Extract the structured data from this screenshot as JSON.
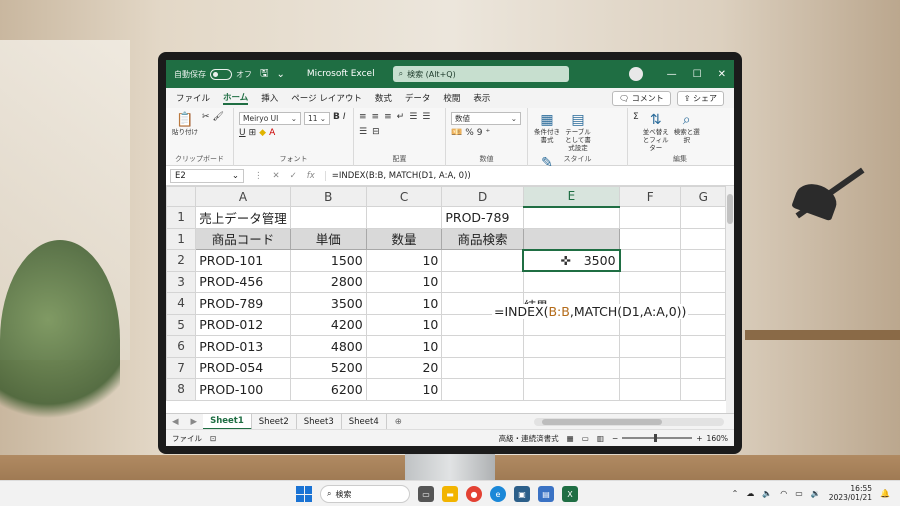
{
  "titlebar": {
    "autosave": "自動保存",
    "autosave_state": "オフ",
    "app": "Microsoft Excel",
    "search": "検索 (Alt+Q)"
  },
  "menu": [
    "ファイル",
    "ホーム",
    "挿入",
    "ページ レイアウト",
    "数式",
    "データ",
    "校閲",
    "表示"
  ],
  "menu_active": "ホーム",
  "menu_right": {
    "comment": "コメント",
    "share": "シェア"
  },
  "ribbon": {
    "paste": "貼り付け",
    "clipboard": "クリップボード",
    "font_name": "Meiryo UI",
    "font_size": "11",
    "font": "フォント",
    "alignment": "配置",
    "number_format": "数値",
    "number": "数値",
    "styles": "スタイル",
    "cond_format": "条件付き書式",
    "table_format": "テーブルとして書式設定",
    "cell_style": "セルのスタイル",
    "editing": "編集",
    "sort": "並べ替えとフィルター",
    "find": "検索と選択"
  },
  "formula_bar": {
    "namebox": "E2",
    "formula": "=INDEX(B:B, MATCH(D1, A:A, 0))"
  },
  "columns": [
    "A",
    "B",
    "C",
    "D",
    "E",
    "F",
    "G"
  ],
  "selected_column": "E",
  "rows": [
    {
      "n": "1",
      "a": "売上データ管理",
      "b": "",
      "c": "",
      "d": "PROD-789",
      "e": ""
    },
    {
      "n": "1",
      "a": "商品コード",
      "b": "単価",
      "c": "数量",
      "d": "商品検索",
      "e": "結果"
    },
    {
      "n": "2",
      "a": "PROD-101",
      "b": "1500",
      "c": "10",
      "d": "",
      "e": "3500"
    },
    {
      "n": "3",
      "a": "PROD-456",
      "b": "2800",
      "c": "10",
      "d": "",
      "e": ""
    },
    {
      "n": "4",
      "a": "PROD-789",
      "b": "3500",
      "c": "10",
      "d": "",
      "e": ""
    },
    {
      "n": "5",
      "a": "PROD-012",
      "b": "4200",
      "c": "10",
      "d": "",
      "e": ""
    },
    {
      "n": "6",
      "a": "PROD-013",
      "b": "4800",
      "c": "10",
      "d": "",
      "e": ""
    },
    {
      "n": "7",
      "a": "PROD-054",
      "b": "5200",
      "c": "20",
      "d": "",
      "e": ""
    },
    {
      "n": "8",
      "a": "PROD-100",
      "b": "6200",
      "c": "10",
      "d": "",
      "e": ""
    }
  ],
  "overlay_formula": {
    "prefix": "=INDEX(",
    "ref": "B:B",
    "suffix": ",MATCH(D1,A:A,0))"
  },
  "sheets": [
    "Sheet1",
    "Sheet2",
    "Sheet3",
    "Sheet4"
  ],
  "active_sheet": "Sheet1",
  "status": {
    "mode": "ファイル",
    "accessibility": "高級・連続済書式",
    "zoom": "160%"
  },
  "taskbar": {
    "search": "検索",
    "time": "16:55",
    "date": "2023/01/21"
  },
  "colors": {
    "excel_green": "#1f6e43",
    "selection": "#1f6e43"
  }
}
